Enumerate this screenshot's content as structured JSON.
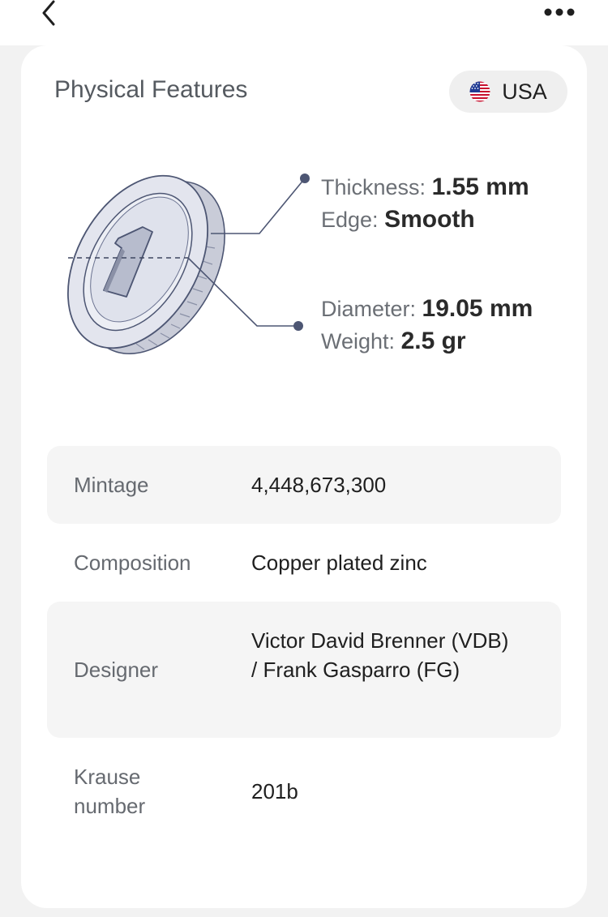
{
  "header": {
    "back_icon": "chevron-left-icon",
    "more_icon": "ellipsis-icon"
  },
  "card": {
    "title": "Physical Features",
    "country": {
      "label": "USA",
      "icon": "us-flag-icon"
    }
  },
  "specs": {
    "thickness_label": "Thickness:",
    "thickness_value": "1.55 mm",
    "edge_label": "Edge:",
    "edge_value": "Smooth",
    "diameter_label": "Diameter:",
    "diameter_value": "19.05 mm",
    "weight_label": "Weight:",
    "weight_value": "2.5 gr"
  },
  "details": [
    {
      "label": "Mintage",
      "value": "4,448,673,300"
    },
    {
      "label": "Composition",
      "value": "Copper plated zinc"
    },
    {
      "label": "Designer",
      "value": "Victor David Brenner (VDB) / Frank Gasparro (FG)"
    },
    {
      "label": "Krause number",
      "value": "201b"
    }
  ],
  "colors": {
    "page_bg": "#f2f2f2",
    "card_bg": "#ffffff",
    "row_shade": "#f5f5f5",
    "coin_outline": "#4d5673",
    "coin_fill": "#e3e5ee"
  }
}
